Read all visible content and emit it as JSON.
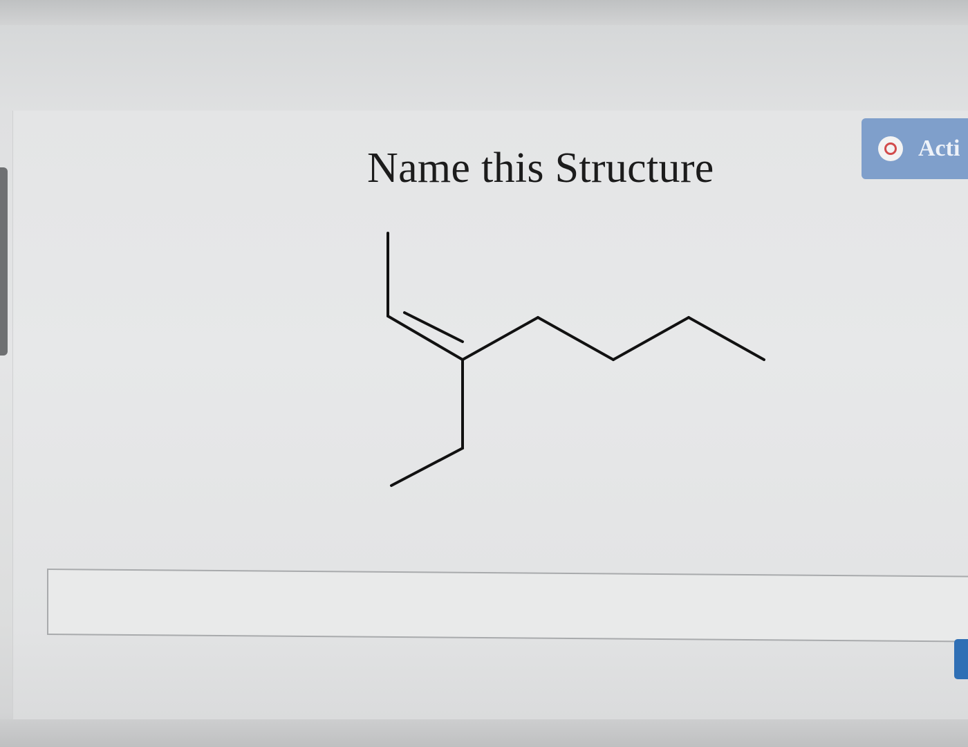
{
  "page": {
    "title": "Name this Structure"
  },
  "action_button": {
    "label": "Acti",
    "icon": "record-circle-icon"
  },
  "structure": {
    "description": "skeletal formula",
    "bond_color": "#111111"
  },
  "answer": {
    "value": "",
    "placeholder": ""
  },
  "colors": {
    "accent": "#7f9fcb",
    "submit": "#2f6fb5",
    "icon_ring": "#d24b4b"
  }
}
